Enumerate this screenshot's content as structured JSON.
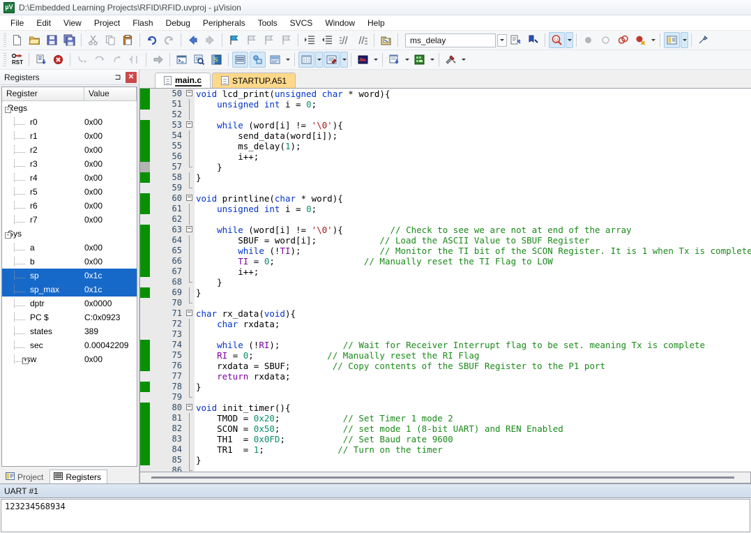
{
  "window": {
    "title": "D:\\Embedded Learning Projects\\RFID\\RFID.uvproj - µVision",
    "app_icon_label": "µV5"
  },
  "menu": {
    "items": [
      "File",
      "Edit",
      "View",
      "Project",
      "Flash",
      "Debug",
      "Peripherals",
      "Tools",
      "SVCS",
      "Window",
      "Help"
    ]
  },
  "toolbar": {
    "search_value": "ms_delay",
    "search_placeholder": "",
    "row1_icons": [
      "new-file-icon",
      "open-file-icon",
      "save-icon",
      "save-all-icon",
      "cut-icon",
      "copy-icon",
      "paste-icon",
      "undo-icon",
      "redo-icon",
      "navigate-back-icon",
      "navigate-forward-icon",
      "bookmark-toggle-icon",
      "bookmark-prev-icon",
      "bookmark-next-icon",
      "bookmark-clear-icon",
      "indent-icon",
      "outdent-icon",
      "comment-icon",
      "uncomment-icon",
      "open-document-icon"
    ],
    "row2_icons": [
      "reset-cpu-icon",
      "run-icon",
      "stop-icon",
      "step-into-icon",
      "step-over-icon",
      "step-out-icon",
      "run-to-cursor-icon",
      "show-next-statement-icon",
      "command-window-icon",
      "disassembly-icon",
      "symbols-icon",
      "registers-window-icon",
      "call-stack-icon",
      "watch-window-icon",
      "memory-window-icon",
      "serial-window-icon",
      "analysis-window-icon",
      "trace-icon",
      "system-viewer-icon",
      "toolbox-icon"
    ],
    "debug_icons": [
      "search-target-icon",
      "insert-bookmark-icon",
      "find-in-files-icon",
      "breakpoint-icon",
      "breakpoint-disable-icon",
      "breakpoint-disable-all-icon",
      "breakpoint-kill-all-icon",
      "manage-components-icon",
      "configuration-icon"
    ]
  },
  "registers_panel": {
    "title": "Registers",
    "pin_icon": "pin-icon",
    "close_icon": "close-icon",
    "columns": [
      "Register",
      "Value"
    ],
    "rows": [
      {
        "name": "Regs",
        "value": "",
        "level": 0,
        "expander": "-",
        "selected": false
      },
      {
        "name": "r0",
        "value": "0x00",
        "level": 1,
        "expander": "",
        "selected": false
      },
      {
        "name": "r1",
        "value": "0x00",
        "level": 1,
        "expander": "",
        "selected": false
      },
      {
        "name": "r2",
        "value": "0x00",
        "level": 1,
        "expander": "",
        "selected": false
      },
      {
        "name": "r3",
        "value": "0x00",
        "level": 1,
        "expander": "",
        "selected": false
      },
      {
        "name": "r4",
        "value": "0x00",
        "level": 1,
        "expander": "",
        "selected": false
      },
      {
        "name": "r5",
        "value": "0x00",
        "level": 1,
        "expander": "",
        "selected": false
      },
      {
        "name": "r6",
        "value": "0x00",
        "level": 1,
        "expander": "",
        "selected": false
      },
      {
        "name": "r7",
        "value": "0x00",
        "level": 1,
        "expander": "",
        "selected": false
      },
      {
        "name": "Sys",
        "value": "",
        "level": 0,
        "expander": "-",
        "selected": false
      },
      {
        "name": "a",
        "value": "0x00",
        "level": 1,
        "expander": "",
        "selected": false
      },
      {
        "name": "b",
        "value": "0x00",
        "level": 1,
        "expander": "",
        "selected": false
      },
      {
        "name": "sp",
        "value": "0x1c",
        "level": 1,
        "expander": "",
        "selected": true
      },
      {
        "name": "sp_max",
        "value": "0x1c",
        "level": 1,
        "expander": "",
        "selected": true
      },
      {
        "name": "dptr",
        "value": "0x0000",
        "level": 1,
        "expander": "",
        "selected": false
      },
      {
        "name": "PC  $",
        "value": "C:0x0923",
        "level": 1,
        "expander": "",
        "selected": false
      },
      {
        "name": "states",
        "value": "389",
        "level": 1,
        "expander": "",
        "selected": false
      },
      {
        "name": "sec",
        "value": "0.00042209",
        "level": 1,
        "expander": "",
        "selected": false
      },
      {
        "name": "psw",
        "value": "0x00",
        "level": 1,
        "expander": "+",
        "selected": false
      }
    ],
    "dock_tabs": [
      {
        "label": "Project",
        "icon": "project-icon",
        "active": false
      },
      {
        "label": "Registers",
        "icon": "registers-icon",
        "active": true
      }
    ]
  },
  "editor": {
    "tabs": [
      {
        "label": "main.c",
        "active": true
      },
      {
        "label": "STARTUP.A51",
        "active": false
      }
    ],
    "first_line": 50,
    "lines": [
      {
        "n": 50,
        "cov": "green",
        "fold": "minus",
        "tokens": [
          {
            "t": "void ",
            "c": "kw"
          },
          {
            "t": "lcd_print(",
            "c": "pl"
          },
          {
            "t": "unsigned char",
            "c": "kw"
          },
          {
            "t": " * word){",
            "c": "pl"
          }
        ]
      },
      {
        "n": 51,
        "cov": "green",
        "fold": "bar",
        "tokens": [
          {
            "t": "    ",
            "c": "pl"
          },
          {
            "t": "unsigned int",
            "c": "kw"
          },
          {
            "t": " i = ",
            "c": "pl"
          },
          {
            "t": "0",
            "c": "num"
          },
          {
            "t": ";",
            "c": "pl"
          }
        ]
      },
      {
        "n": 52,
        "cov": "none",
        "fold": "bar",
        "tokens": []
      },
      {
        "n": 53,
        "cov": "green",
        "fold": "minus",
        "tokens": [
          {
            "t": "    ",
            "c": "pl"
          },
          {
            "t": "while",
            "c": "kw"
          },
          {
            "t": " (word[i] != ",
            "c": "pl"
          },
          {
            "t": "'\\0'",
            "c": "str"
          },
          {
            "t": "){",
            "c": "pl"
          }
        ]
      },
      {
        "n": 54,
        "cov": "green",
        "fold": "bar",
        "tokens": [
          {
            "t": "        send_data(word[i]);",
            "c": "pl"
          }
        ]
      },
      {
        "n": 55,
        "cov": "green",
        "fold": "bar",
        "tokens": [
          {
            "t": "        ms_delay(",
            "c": "pl"
          },
          {
            "t": "1",
            "c": "num"
          },
          {
            "t": ");",
            "c": "pl"
          }
        ]
      },
      {
        "n": 56,
        "cov": "green",
        "fold": "bar",
        "tokens": [
          {
            "t": "        i++;",
            "c": "pl"
          }
        ]
      },
      {
        "n": 57,
        "cov": "gray",
        "fold": "end",
        "tokens": [
          {
            "t": "    }",
            "c": "pl"
          }
        ]
      },
      {
        "n": 58,
        "cov": "green",
        "fold": "bar",
        "tokens": [
          {
            "t": "}",
            "c": "pl"
          }
        ]
      },
      {
        "n": 59,
        "cov": "none",
        "fold": "end",
        "tokens": []
      },
      {
        "n": 60,
        "cov": "green",
        "fold": "minus",
        "tokens": [
          {
            "t": "void ",
            "c": "kw"
          },
          {
            "t": "printline(",
            "c": "pl"
          },
          {
            "t": "char",
            "c": "kw"
          },
          {
            "t": " * word){",
            "c": "pl"
          }
        ]
      },
      {
        "n": 61,
        "cov": "green",
        "fold": "bar",
        "tokens": [
          {
            "t": "    ",
            "c": "pl"
          },
          {
            "t": "unsigned int",
            "c": "kw"
          },
          {
            "t": " i = ",
            "c": "pl"
          },
          {
            "t": "0",
            "c": "num"
          },
          {
            "t": ";",
            "c": "pl"
          }
        ]
      },
      {
        "n": 62,
        "cov": "none",
        "fold": "bar",
        "tokens": []
      },
      {
        "n": 63,
        "cov": "green",
        "fold": "minus",
        "tokens": [
          {
            "t": "    ",
            "c": "pl"
          },
          {
            "t": "while",
            "c": "kw"
          },
          {
            "t": " (word[i] != ",
            "c": "pl"
          },
          {
            "t": "'\\0'",
            "c": "str"
          },
          {
            "t": "){",
            "c": "pl"
          },
          {
            "t": "         ",
            "c": "pl"
          },
          {
            "t": "// Check to see we are not at end of the array",
            "c": "cmt"
          }
        ]
      },
      {
        "n": 64,
        "cov": "green",
        "fold": "bar",
        "tokens": [
          {
            "t": "        SBUF = word[i];",
            "c": "pl"
          },
          {
            "t": "            ",
            "c": "pl"
          },
          {
            "t": "// Load the ASCII Value to SBUF Register",
            "c": "cmt"
          }
        ]
      },
      {
        "n": 65,
        "cov": "green",
        "fold": "bar",
        "tokens": [
          {
            "t": "        ",
            "c": "pl"
          },
          {
            "t": "while",
            "c": "kw"
          },
          {
            "t": " (!",
            "c": "pl"
          },
          {
            "t": "TI",
            "c": "kw2"
          },
          {
            "t": ");",
            "c": "pl"
          },
          {
            "t": "               ",
            "c": "pl"
          },
          {
            "t": "// Monitor the TI bit of the SCON Register. It is 1 when Tx is complete",
            "c": "cmt"
          }
        ]
      },
      {
        "n": 66,
        "cov": "green",
        "fold": "bar",
        "tokens": [
          {
            "t": "        ",
            "c": "pl"
          },
          {
            "t": "TI",
            "c": "kw2"
          },
          {
            "t": " = ",
            "c": "pl"
          },
          {
            "t": "0",
            "c": "num"
          },
          {
            "t": ";",
            "c": "pl"
          },
          {
            "t": "                 ",
            "c": "pl"
          },
          {
            "t": "// Manually reset the TI Flag to LOW",
            "c": "cmt"
          }
        ]
      },
      {
        "n": 67,
        "cov": "green",
        "fold": "bar",
        "tokens": [
          {
            "t": "        i++;",
            "c": "pl"
          }
        ]
      },
      {
        "n": 68,
        "cov": "none",
        "fold": "end",
        "tokens": [
          {
            "t": "    }",
            "c": "pl"
          }
        ]
      },
      {
        "n": 69,
        "cov": "green",
        "fold": "bar",
        "tokens": [
          {
            "t": "}",
            "c": "pl"
          }
        ]
      },
      {
        "n": 70,
        "cov": "none",
        "fold": "end",
        "tokens": []
      },
      {
        "n": 71,
        "cov": "none",
        "fold": "minus",
        "tokens": [
          {
            "t": "char ",
            "c": "kw"
          },
          {
            "t": "rx_data(",
            "c": "pl"
          },
          {
            "t": "void",
            "c": "kw"
          },
          {
            "t": "){",
            "c": "pl"
          }
        ]
      },
      {
        "n": 72,
        "cov": "none",
        "fold": "bar",
        "tokens": [
          {
            "t": "    ",
            "c": "pl"
          },
          {
            "t": "char",
            "c": "kw"
          },
          {
            "t": " rxdata;",
            "c": "pl"
          }
        ]
      },
      {
        "n": 73,
        "cov": "none",
        "fold": "bar",
        "tokens": []
      },
      {
        "n": 74,
        "cov": "green",
        "fold": "bar",
        "tokens": [
          {
            "t": "    ",
            "c": "pl"
          },
          {
            "t": "while",
            "c": "kw"
          },
          {
            "t": " (!",
            "c": "pl"
          },
          {
            "t": "RI",
            "c": "kw2"
          },
          {
            "t": ");",
            "c": "pl"
          },
          {
            "t": "            ",
            "c": "pl"
          },
          {
            "t": "// Wait for Receiver Interrupt flag to be set. meaning Tx is complete",
            "c": "cmt"
          }
        ]
      },
      {
        "n": 75,
        "cov": "green",
        "fold": "bar",
        "tokens": [
          {
            "t": "    ",
            "c": "pl"
          },
          {
            "t": "RI",
            "c": "kw2"
          },
          {
            "t": " = ",
            "c": "pl"
          },
          {
            "t": "0",
            "c": "num"
          },
          {
            "t": ";",
            "c": "pl"
          },
          {
            "t": "              ",
            "c": "pl"
          },
          {
            "t": "// Manually reset the RI Flag",
            "c": "cmt"
          }
        ]
      },
      {
        "n": 76,
        "cov": "green",
        "fold": "bar",
        "tokens": [
          {
            "t": "    rxdata = SBUF;",
            "c": "pl"
          },
          {
            "t": "        ",
            "c": "pl"
          },
          {
            "t": "// Copy contents of the SBUF Register to the P1 port",
            "c": "cmt"
          }
        ]
      },
      {
        "n": 77,
        "cov": "none",
        "fold": "bar",
        "tokens": [
          {
            "t": "    ",
            "c": "pl"
          },
          {
            "t": "return",
            "c": "kw2"
          },
          {
            "t": " rxdata;",
            "c": "pl"
          }
        ]
      },
      {
        "n": 78,
        "cov": "green",
        "fold": "bar",
        "tokens": [
          {
            "t": "}",
            "c": "pl"
          }
        ]
      },
      {
        "n": 79,
        "cov": "none",
        "fold": "end",
        "tokens": []
      },
      {
        "n": 80,
        "cov": "green",
        "fold": "minus",
        "tokens": [
          {
            "t": "void ",
            "c": "kw"
          },
          {
            "t": "init_timer(){",
            "c": "pl"
          }
        ]
      },
      {
        "n": 81,
        "cov": "green",
        "fold": "bar",
        "tokens": [
          {
            "t": "    TMOD = ",
            "c": "pl"
          },
          {
            "t": "0x20",
            "c": "num"
          },
          {
            "t": ";",
            "c": "pl"
          },
          {
            "t": "            ",
            "c": "pl"
          },
          {
            "t": "// Set Timer 1 mode 2",
            "c": "cmt"
          }
        ]
      },
      {
        "n": 82,
        "cov": "green",
        "fold": "bar",
        "tokens": [
          {
            "t": "    SCON = ",
            "c": "pl"
          },
          {
            "t": "0x50",
            "c": "num"
          },
          {
            "t": ";",
            "c": "pl"
          },
          {
            "t": "            ",
            "c": "pl"
          },
          {
            "t": "// set mode 1 (8-bit UART) and REN Enabled",
            "c": "cmt"
          }
        ]
      },
      {
        "n": 83,
        "cov": "green",
        "fold": "bar",
        "tokens": [
          {
            "t": "    TH1  = ",
            "c": "pl"
          },
          {
            "t": "0x0FD",
            "c": "num"
          },
          {
            "t": ";",
            "c": "pl"
          },
          {
            "t": "           ",
            "c": "pl"
          },
          {
            "t": "// Set Baud rate 9600",
            "c": "cmt"
          }
        ]
      },
      {
        "n": 84,
        "cov": "green",
        "fold": "bar",
        "tokens": [
          {
            "t": "    TR1  = ",
            "c": "pl"
          },
          {
            "t": "1",
            "c": "num"
          },
          {
            "t": ";",
            "c": "pl"
          },
          {
            "t": "              ",
            "c": "pl"
          },
          {
            "t": "// Turn on the timer",
            "c": "cmt"
          }
        ]
      },
      {
        "n": 85,
        "cov": "green",
        "fold": "bar",
        "tokens": [
          {
            "t": "}",
            "c": "pl"
          }
        ]
      },
      {
        "n": 86,
        "cov": "none",
        "fold": "end",
        "tokens": []
      }
    ]
  },
  "uart_panel": {
    "title": "UART #1",
    "content": "123234568934"
  },
  "colors": {
    "selection_blue": "#1669c8",
    "coverage_green": "#089000",
    "coverage_gray": "#b3b3b3",
    "tab_inactive_orange": "#ffd88a",
    "comment_green": "#1a8a1a",
    "keyword_blue": "#0033cc"
  }
}
